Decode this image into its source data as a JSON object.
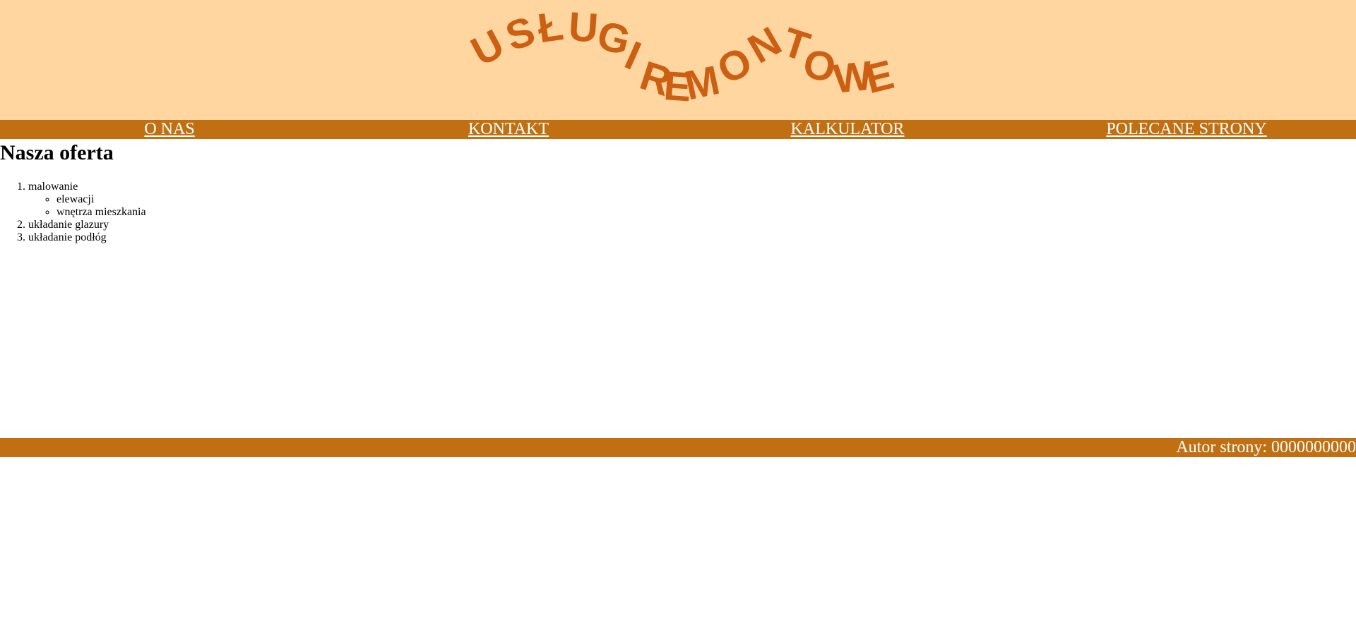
{
  "header": {
    "logo_text": "USŁUGI REMONTOWE",
    "logo_color": "#cc5f12",
    "banner_color": "#ffd5a0"
  },
  "nav": {
    "items": [
      {
        "label": "O NAS"
      },
      {
        "label": "KONTAKT"
      },
      {
        "label": "KALKULATOR"
      },
      {
        "label": "POLECANE STRONY"
      }
    ],
    "color": "#c07012"
  },
  "main": {
    "title": "Nasza oferta",
    "list": [
      {
        "label": "malowanie",
        "sub": [
          "elewacji",
          "wnętrza mieszkania"
        ]
      },
      {
        "label": "układanie glazury"
      },
      {
        "label": "układanie podłóg"
      }
    ]
  },
  "footer": {
    "text": "Autor strony: 0000000000"
  }
}
